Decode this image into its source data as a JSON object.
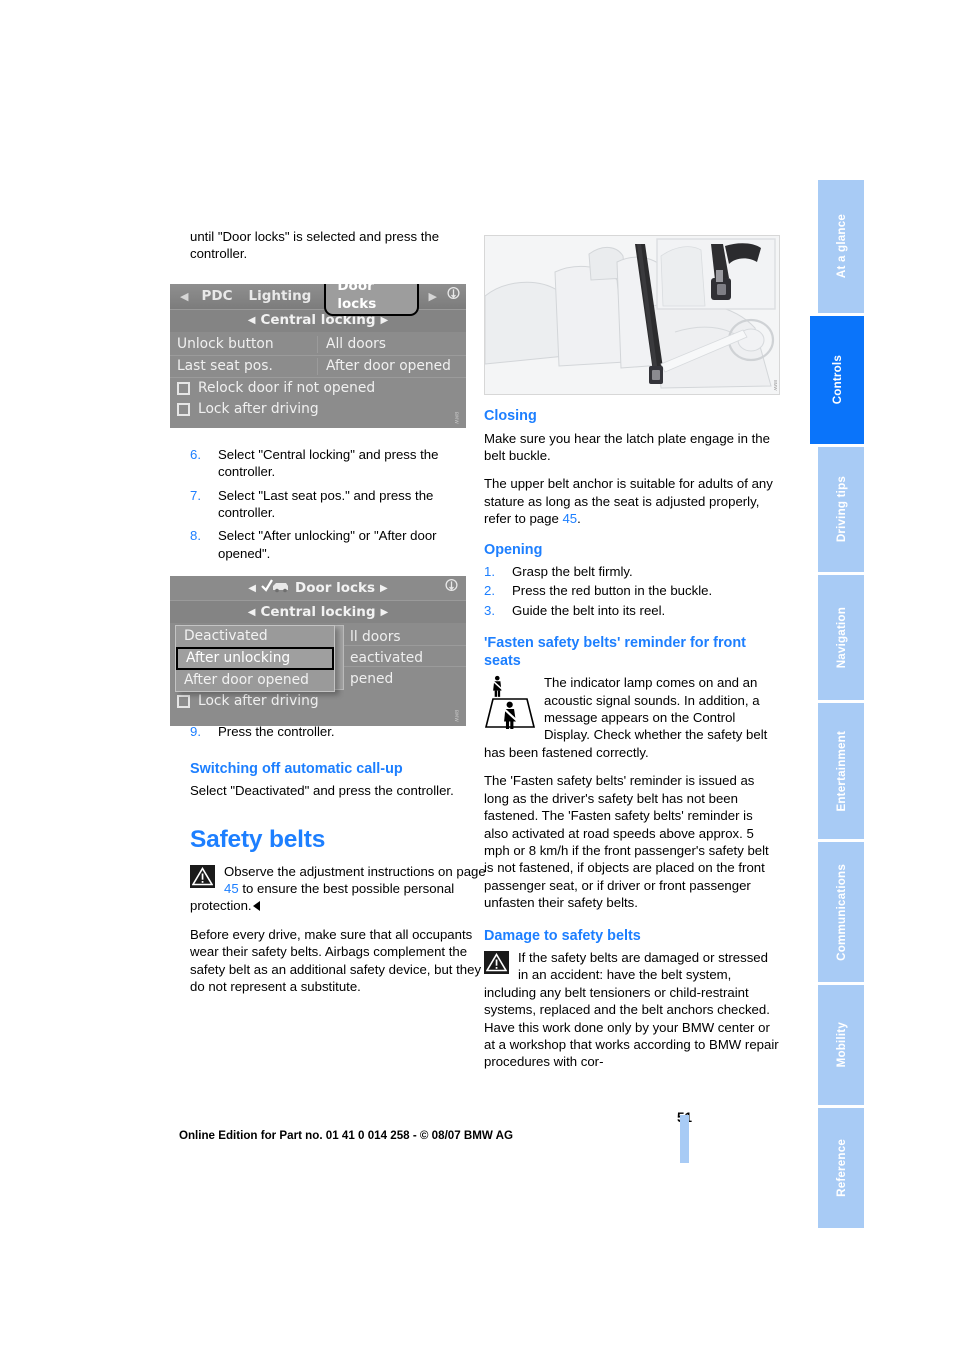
{
  "page": {
    "number": "51",
    "footer": "Online Edition for Part no. 01 41 0 014 258 - © 08/07 BMW AG"
  },
  "rail": {
    "tabs": [
      {
        "label": "At a glance",
        "active": false
      },
      {
        "label": "Controls",
        "active": true
      },
      {
        "label": "Driving tips",
        "active": false
      },
      {
        "label": "Navigation",
        "active": false
      },
      {
        "label": "Entertainment",
        "active": false
      },
      {
        "label": "Communications",
        "active": false
      },
      {
        "label": "Mobility",
        "active": false
      },
      {
        "label": "Reference",
        "active": false
      }
    ],
    "accent_active": "#0a74fa",
    "accent_inactive": "#a8cbf5"
  },
  "left_column": {
    "intro": "until \"Door locks\" is selected and press the controller.",
    "steps": [
      {
        "num": "6.",
        "text": "Select \"Central locking\" and press the controller."
      },
      {
        "num": "7.",
        "text": "Select \"Last seat pos.\" and press the controller."
      },
      {
        "num": "8.",
        "text": "Select \"After unlocking\" or \"After door opened\"."
      },
      {
        "num": "9.",
        "text": "Press the controller."
      }
    ],
    "switching_off": {
      "heading": "Switching off automatic call-up",
      "body": "Select \"Deactivated\" and press the controller."
    },
    "safety_belts": {
      "heading": "Safety belts",
      "warning_pre": "Observe the adjustment instructions on page ",
      "warning_ref": "45",
      "warning_post": " to ensure the best possible personal protection.",
      "body": "Before every drive, make sure that all occupants wear their safety belts. Airbags complement the safety belt as an additional safety device, but they do not represent a substitute."
    }
  },
  "idrive_1": {
    "topbar": {
      "prev_arrow": "◀",
      "items": [
        "PDC",
        "Lighting"
      ],
      "selected": "Door locks",
      "next_arrow": "▶",
      "gear": "gear-icon"
    },
    "breadcrumb": "Central locking",
    "rows": [
      {
        "key": "Unlock button",
        "value": "All doors"
      },
      {
        "key": "Last seat pos.",
        "value": "After door opened"
      }
    ],
    "checkboxes": [
      {
        "label": "Relock door if not opened",
        "checked": false
      },
      {
        "label": "Lock after driving",
        "checked": false
      }
    ]
  },
  "idrive_2": {
    "title": "Door locks",
    "breadcrumb": "Central locking",
    "dropdown": {
      "options": [
        "Deactivated",
        "After unlocking",
        "After door opened"
      ],
      "selected": "After unlocking"
    },
    "behind": [
      "ll doors",
      "eactivated",
      "pened"
    ],
    "checkbox": {
      "label": "Lock after driving",
      "checked": false
    }
  },
  "right_column": {
    "closing": {
      "heading": "Closing",
      "p1": "Make sure you hear the latch plate engage in the belt buckle.",
      "p2_pre": "The upper belt anchor is suitable for adults of any stature as long as the seat is adjusted properly, refer to page ",
      "p2_ref": "45",
      "p2_post": "."
    },
    "opening": {
      "heading": "Opening",
      "steps": [
        {
          "num": "1.",
          "text": "Grasp the belt firmly."
        },
        {
          "num": "2.",
          "text": "Press the red button in the buckle."
        },
        {
          "num": "3.",
          "text": "Guide the belt into its reel."
        }
      ]
    },
    "reminder": {
      "heading": "'Fasten safety belts' reminder for front seats",
      "p1": "The indicator lamp comes on and an acoustic signal sounds. In addition, a message appears on the Control Display. Check whether the safety belt has been fastened correctly.",
      "p2": "The 'Fasten safety belts' reminder is issued as long as the driver's safety belt has not been fastened. The 'Fasten safety belts' reminder is also activated at road speeds above approx. 5 mph or 8 km/h if the front passenger's safety belt is not fastened, if objects are placed on the front passenger seat, or if driver or front passenger unfasten their safety belts."
    },
    "damage": {
      "heading": "Damage to safety belts",
      "warning": "If the safety belts are damaged or stressed in an accident: have the belt system, including any belt tensioners or child-restraint systems, replaced and the belt anchors checked. Have this work done only by your BMW center or at a workshop that works according to BMW repair procedures with cor-"
    }
  }
}
